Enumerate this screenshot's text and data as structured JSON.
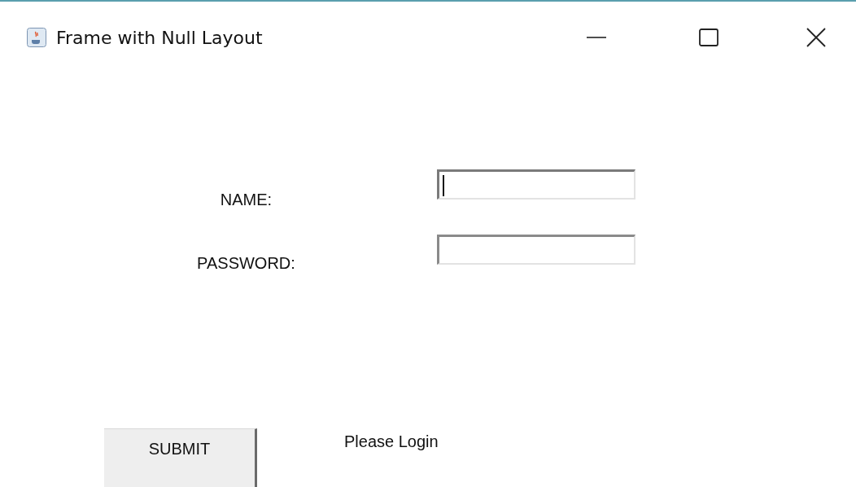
{
  "window": {
    "title": "Frame with Null Layout"
  },
  "form": {
    "fields": [
      {
        "label": "NAME:",
        "focused": true
      },
      {
        "label": "PASSWORD:",
        "focused": false
      }
    ],
    "submit_button": "SUBMIT",
    "status": "Please Login"
  }
}
